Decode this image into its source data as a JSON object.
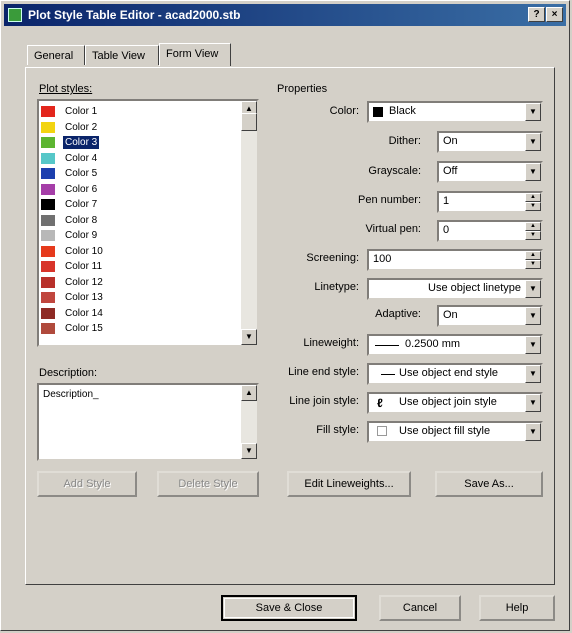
{
  "window": {
    "title": "Plot Style Table Editor - acad2000.stb",
    "help_btn": "?",
    "close_btn": "×"
  },
  "tabs": [
    {
      "label": "General"
    },
    {
      "label": "Table View"
    },
    {
      "label": "Form View"
    }
  ],
  "plot_styles": {
    "label": "Plot styles:",
    "items": [
      {
        "name": "Color 1",
        "color": "#e3261c"
      },
      {
        "name": "Color 2",
        "color": "#f2d411"
      },
      {
        "name": "Color 3",
        "color": "#5cb531"
      },
      {
        "name": "Color 4",
        "color": "#56c7c8"
      },
      {
        "name": "Color 5",
        "color": "#1c3fae"
      },
      {
        "name": "Color 6",
        "color": "#a53ea8"
      },
      {
        "name": "Color 7",
        "color": "#000000"
      },
      {
        "name": "Color 8",
        "color": "#707070"
      },
      {
        "name": "Color 9",
        "color": "#b8b8b8"
      },
      {
        "name": "Color 10",
        "color": "#e63a1c"
      },
      {
        "name": "Color 11",
        "color": "#d8342a"
      },
      {
        "name": "Color 12",
        "color": "#b8302a"
      },
      {
        "name": "Color 13",
        "color": "#c0463e"
      },
      {
        "name": "Color 14",
        "color": "#8e2a24"
      },
      {
        "name": "Color 15",
        "color": "#b04a3c"
      }
    ],
    "selected_index": 2
  },
  "description": {
    "label": "Description:",
    "value": "Description_"
  },
  "properties": {
    "label": "Properties",
    "color": {
      "label": "Color:",
      "value": "Black",
      "swatch": "#000000"
    },
    "dither": {
      "label": "Dither:",
      "value": "On"
    },
    "grayscale": {
      "label": "Grayscale:",
      "value": "Off"
    },
    "pen_number": {
      "label": "Pen number:",
      "value": "1"
    },
    "virtual_pen": {
      "label": "Virtual pen:",
      "value": "0"
    },
    "screening": {
      "label": "Screening:",
      "value": "100"
    },
    "linetype": {
      "label": "Linetype:",
      "value": "Use object linetype"
    },
    "adaptive": {
      "label": "Adaptive:",
      "value": "On"
    },
    "lineweight": {
      "label": "Lineweight:",
      "value": "0.2500 mm"
    },
    "line_end_style": {
      "label": "Line end style:",
      "value": "Use object end style"
    },
    "line_join_style": {
      "label": "Line join style:",
      "value": "Use object join style"
    },
    "fill_style": {
      "label": "Fill style:",
      "value": "Use object fill style"
    }
  },
  "buttons": {
    "add_style": "Add Style",
    "delete_style": "Delete Style",
    "edit_lineweights": "Edit Lineweights...",
    "save_as": "Save As...",
    "save_close": "Save & Close",
    "cancel": "Cancel",
    "help": "Help"
  }
}
